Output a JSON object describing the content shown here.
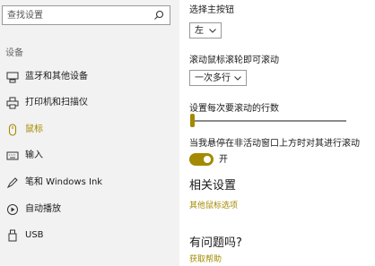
{
  "search": {
    "placeholder": "查找设置",
    "icon": "search-icon"
  },
  "sidebar": {
    "section": "设备",
    "active_color": "#a38a00",
    "items": [
      {
        "label": "蓝牙和其他设备",
        "icon": "bluetooth-devices-icon"
      },
      {
        "label": "打印机和扫描仪",
        "icon": "printer-icon"
      },
      {
        "label": "鼠标",
        "icon": "mouse-icon",
        "active": true
      },
      {
        "label": "输入",
        "icon": "keyboard-icon"
      },
      {
        "label": "笔和 Windows Ink",
        "icon": "pen-icon"
      },
      {
        "label": "自动播放",
        "icon": "autoplay-icon"
      },
      {
        "label": "USB",
        "icon": "usb-icon"
      }
    ]
  },
  "main": {
    "primary_button": {
      "label": "选择主按钮",
      "value": "左"
    },
    "scroll_mode": {
      "label": "滚动鼠标滚轮即可滚动",
      "value": "一次多行"
    },
    "lines_to_scroll": {
      "label": "设置每次要滚动的行数",
      "value_fraction": 0.0
    },
    "inactive_scroll": {
      "label": "当我悬停在非活动窗口上方时对其进行滚动",
      "state": "开",
      "on": true
    },
    "related": {
      "heading": "相关设置",
      "link": "其他鼠标选项"
    },
    "help": {
      "heading": "有问题吗?",
      "link": "获取帮助"
    }
  },
  "colors": {
    "accent": "#a38a00",
    "sidebar_bg": "#f2f2f2",
    "main_bg": "#ffffff"
  }
}
